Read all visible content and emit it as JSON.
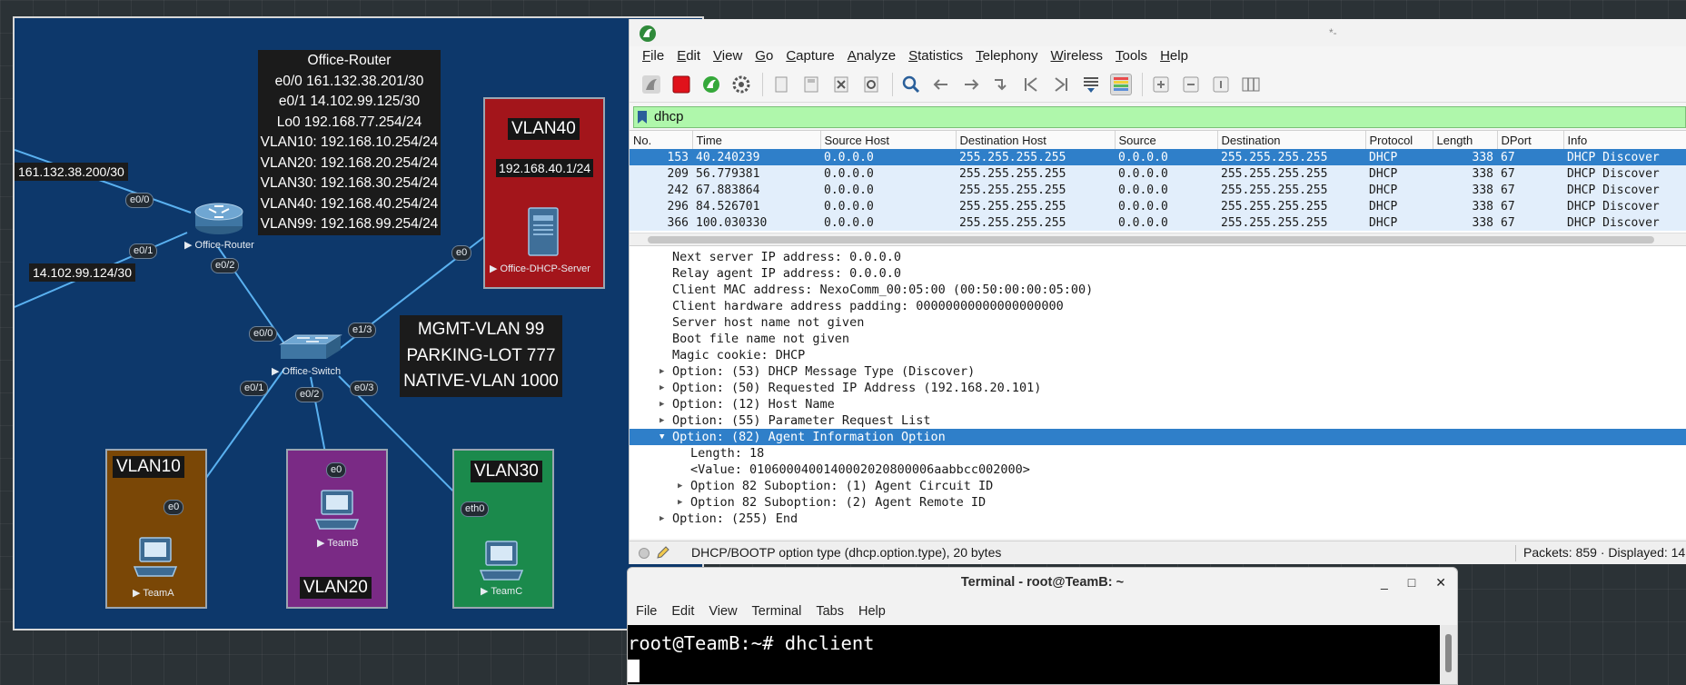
{
  "topology": {
    "router_note": [
      "Office-Router",
      "e0/0 161.132.38.201/30",
      "e0/1 14.102.99.125/30",
      "Lo0 192.168.77.254/24",
      "VLAN10: 192.168.10.254/24",
      "VLAN20: 192.168.20.254/24",
      "VLAN30: 192.168.30.254/24",
      "VLAN40: 192.168.40.254/24",
      "VLAN99: 192.168.99.254/24"
    ],
    "vlan_note": [
      "MGMT-VLAN 99",
      "PARKING-LOT 777",
      "NATIVE-VLAN 1000"
    ],
    "wan_subnet_1": "161.132.38.200/30",
    "wan_subnet_2": "14.102.99.124/30",
    "vlan40_title": "VLAN40",
    "vlan40_subnet": "192.168.40.1/24",
    "vlan10_title": "VLAN10",
    "vlan20_title": "VLAN20",
    "vlan30_title": "VLAN30",
    "devices": {
      "router": "▶ Office-Router",
      "switch": "▶ Office-Switch",
      "dhcp": "▶ Office-DHCP-Server",
      "teamA": "▶ TeamA",
      "teamB": "▶ TeamB",
      "teamC": "▶ TeamC"
    },
    "ports": {
      "r_e00": "e0/0",
      "r_e01": "e0/1",
      "r_e02": "e0/2",
      "s_e00": "e0/0",
      "s_e13": "e1/3",
      "s_e01": "e0/1",
      "s_e02": "e0/2",
      "s_e03": "e0/3",
      "dhcp_e0": "e0",
      "teamA_e0": "e0",
      "teamB_e0": "e0",
      "teamC_eth0": "eth0"
    }
  },
  "wireshark": {
    "window_title": "*-",
    "menu": [
      "File",
      "Edit",
      "View",
      "Go",
      "Capture",
      "Analyze",
      "Statistics",
      "Telephony",
      "Wireless",
      "Tools",
      "Help"
    ],
    "filter": "dhcp",
    "columns": [
      "No.",
      "Time",
      "Source Host",
      "Destination Host",
      "Source",
      "Destination",
      "Protocol",
      "Length",
      "DPort",
      "Info"
    ],
    "packets": [
      [
        "153",
        "40.240239",
        "0.0.0.0",
        "255.255.255.255",
        "0.0.0.0",
        "255.255.255.255",
        "DHCP",
        "338",
        "67",
        "DHCP Discover"
      ],
      [
        "209",
        "56.779381",
        "0.0.0.0",
        "255.255.255.255",
        "0.0.0.0",
        "255.255.255.255",
        "DHCP",
        "338",
        "67",
        "DHCP Discover"
      ],
      [
        "242",
        "67.883864",
        "0.0.0.0",
        "255.255.255.255",
        "0.0.0.0",
        "255.255.255.255",
        "DHCP",
        "338",
        "67",
        "DHCP Discover"
      ],
      [
        "296",
        "84.526701",
        "0.0.0.0",
        "255.255.255.255",
        "0.0.0.0",
        "255.255.255.255",
        "DHCP",
        "338",
        "67",
        "DHCP Discover"
      ],
      [
        "366",
        "100.030330",
        "0.0.0.0",
        "255.255.255.255",
        "0.0.0.0",
        "255.255.255.255",
        "DHCP",
        "338",
        "67",
        "DHCP Discover"
      ]
    ],
    "details": [
      {
        "text": "Next server IP address: 0.0.0.0",
        "indent": 0,
        "arrow": ""
      },
      {
        "text": "Relay agent IP address: 0.0.0.0",
        "indent": 0,
        "arrow": ""
      },
      {
        "text": "Client MAC address: NexoComm_00:05:00 (00:50:00:00:05:00)",
        "indent": 0,
        "arrow": ""
      },
      {
        "text": "Client hardware address padding: 00000000000000000000",
        "indent": 0,
        "arrow": ""
      },
      {
        "text": "Server host name not given",
        "indent": 0,
        "arrow": ""
      },
      {
        "text": "Boot file name not given",
        "indent": 0,
        "arrow": ""
      },
      {
        "text": "Magic cookie: DHCP",
        "indent": 0,
        "arrow": ""
      },
      {
        "text": "Option: (53) DHCP Message Type (Discover)",
        "indent": 0,
        "arrow": "▶"
      },
      {
        "text": "Option: (50) Requested IP Address (192.168.20.101)",
        "indent": 0,
        "arrow": "▶"
      },
      {
        "text": "Option: (12) Host Name",
        "indent": 0,
        "arrow": "▶"
      },
      {
        "text": "Option: (55) Parameter Request List",
        "indent": 0,
        "arrow": "▶"
      },
      {
        "text": "Option: (82) Agent Information Option",
        "indent": 0,
        "arrow": "▼",
        "selected": true
      },
      {
        "text": "Length: 18",
        "indent": 1,
        "arrow": ""
      },
      {
        "text": "<Value: 0106000400140002020800006aabbcc002000>",
        "indent": 1,
        "arrow": ""
      },
      {
        "text": "Option 82 Suboption: (1) Agent Circuit ID",
        "indent": 1,
        "arrow": "▶"
      },
      {
        "text": "Option 82 Suboption: (2) Agent Remote ID",
        "indent": 1,
        "arrow": "▶"
      },
      {
        "text": "Option: (255) End",
        "indent": 0,
        "arrow": "▶"
      }
    ],
    "status_text": "DHCP/BOOTP option type (dhcp.option.type), 20 bytes",
    "status_packets": "Packets: 859 · Displayed: 14"
  },
  "terminal": {
    "title": "Terminal - root@TeamB: ~",
    "controls": [
      "_",
      "□",
      "✕"
    ],
    "menu": [
      "File",
      "Edit",
      "View",
      "Terminal",
      "Tabs",
      "Help"
    ],
    "prompt_line": "root@TeamB:~# dhclient"
  },
  "colors": {
    "canvas": "#0d386b",
    "vlan40": "#a3151b",
    "vlan10": "#7a4706",
    "vlan20": "#7a2a85",
    "vlan30": "#1b8a4c",
    "selected_row": "#2f7fc9",
    "filter_ok": "#aff7ab"
  }
}
